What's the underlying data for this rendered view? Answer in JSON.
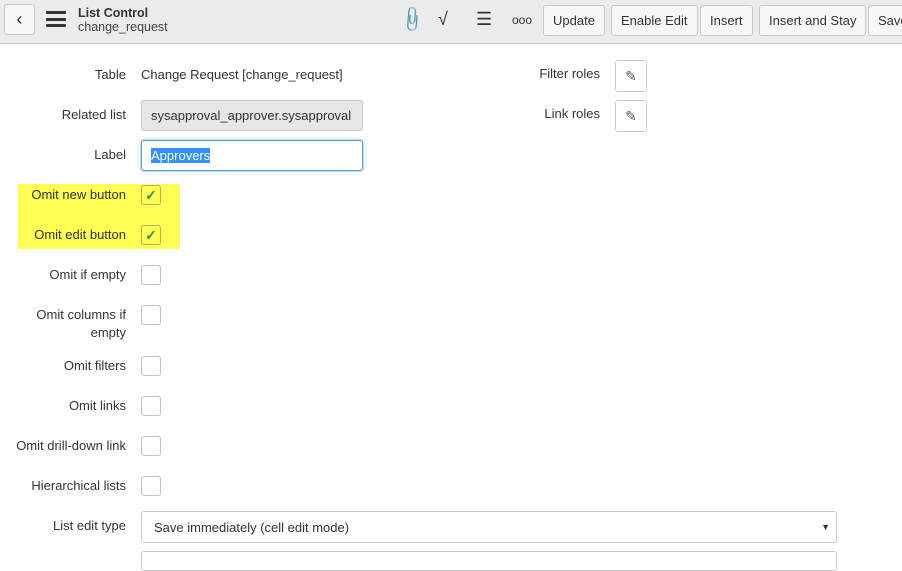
{
  "header": {
    "title": "List Control",
    "subtitle": "change_request",
    "buttons": [
      "Update",
      "Enable Edit",
      "Insert",
      "Insert and Stay",
      "Save"
    ]
  },
  "form": {
    "table_label": "Table",
    "table_value": "Change Request [change_request]",
    "related_label": "Related list",
    "related_value": "sysapproval_approver.sysapproval",
    "label_label": "Label",
    "label_value": "Approvers",
    "filter_roles": "Filter roles",
    "link_roles": "Link roles",
    "checkboxes": [
      {
        "label": "Omit new button",
        "checked": true
      },
      {
        "label": "Omit edit button",
        "checked": true
      },
      {
        "label": "Omit if empty",
        "checked": false
      },
      {
        "label": "Omit columns if empty",
        "checked": false
      },
      {
        "label": "Omit filters",
        "checked": false
      },
      {
        "label": "Omit links",
        "checked": false
      },
      {
        "label": "Omit drill-down link",
        "checked": false
      },
      {
        "label": "Hierarchical lists",
        "checked": false
      }
    ],
    "list_edit_label": "List edit type",
    "list_edit_value": "Save immediately (cell edit mode)"
  }
}
